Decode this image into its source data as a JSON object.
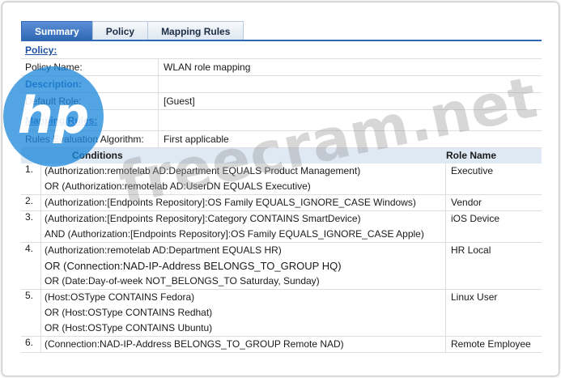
{
  "tabs": [
    {
      "label": "Summary",
      "active": true
    },
    {
      "label": "Policy",
      "active": false
    },
    {
      "label": "Mapping Rules",
      "active": false
    }
  ],
  "policy": {
    "header": "Policy:",
    "name_label": "Policy Name:",
    "name_value": "WLAN role mapping",
    "description_label": "Description:",
    "description_value": "",
    "default_role_label": "Default Role:",
    "default_role_value": "[Guest]"
  },
  "mapping": {
    "header": "Mapping Rules:",
    "algorithm_label": "Rules Evaluation Algorithm:",
    "algorithm_value": "First applicable",
    "conditions_header": "Conditions",
    "role_header": "Role Name",
    "rules": [
      {
        "num": "1.",
        "lines": [
          "(Authorization:remotelab AD:Department EQUALS Product Management)",
          "OR (Authorization:remotelab AD:UserDN EQUALS Executive)"
        ],
        "role": "Executive"
      },
      {
        "num": "2.",
        "lines": [
          "(Authorization:[Endpoints Repository]:OS Family EQUALS_IGNORE_CASE Windows)"
        ],
        "role": "Vendor"
      },
      {
        "num": "3.",
        "lines": [
          "(Authorization:[Endpoints Repository]:Category CONTAINS SmartDevice)",
          "AND (Authorization:[Endpoints Repository]:OS Family EQUALS_IGNORE_CASE Apple)"
        ],
        "role": "iOS Device"
      },
      {
        "num": "4.",
        "lines": [
          "(Authorization:remotelab AD:Department EQUALS HR)",
          "OR (Connection:NAD-IP-Address BELONGS_TO_GROUP HQ)",
          "OR (Date:Day-of-week NOT_BELONGS_TO Saturday, Sunday)"
        ],
        "role": "HR Local"
      },
      {
        "num": "5.",
        "lines": [
          "(Host:OSType CONTAINS Fedora)",
          "OR (Host:OSType CONTAINS Redhat)",
          "OR (Host:OSType CONTAINS Ubuntu)"
        ],
        "role": "Linux User"
      },
      {
        "num": "6.",
        "lines": [
          "(Connection:NAD-IP-Address BELONGS_TO_GROUP Remote NAD)"
        ],
        "role": "Remote Employee"
      }
    ]
  },
  "watermark": {
    "text": "freecram.net",
    "logo_text": "hp",
    "logo_color": "#1e88d9"
  },
  "colors": {
    "accent": "#2f67b4",
    "header_bg": "#dfe9f4",
    "link": "#1d4fa3"
  }
}
